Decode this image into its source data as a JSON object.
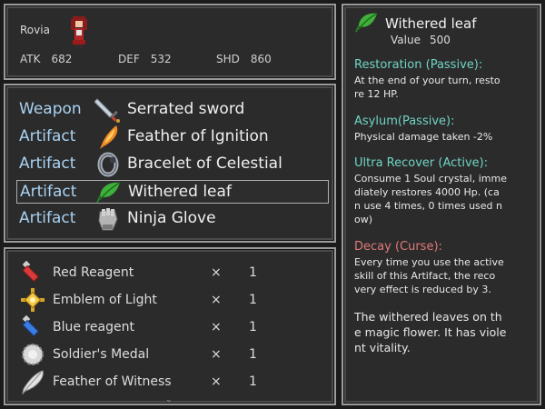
{
  "character": {
    "name": "Rovia",
    "stats": [
      {
        "key": "ATK",
        "value": "682"
      },
      {
        "key": "DEF",
        "value": "532"
      },
      {
        "key": "SHD",
        "value": "860"
      }
    ]
  },
  "equipment": [
    {
      "slot": "Weapon",
      "name": "Serrated sword",
      "icon": "sword-icon"
    },
    {
      "slot": "Artifact",
      "name": "Feather of Ignition",
      "icon": "flame-feather-icon"
    },
    {
      "slot": "Artifact",
      "name": "Bracelet of Celestial",
      "icon": "bracelet-icon"
    },
    {
      "slot": "Artifact",
      "name": "Withered leaf",
      "icon": "leaf-icon",
      "selected": true
    },
    {
      "slot": "Artifact",
      "name": "Ninja Glove",
      "icon": "glove-icon"
    }
  ],
  "inventory": [
    {
      "name": "Red Reagent",
      "x": "×",
      "qty": "1",
      "icon": "red-vial-icon"
    },
    {
      "name": "Emblem of Light",
      "x": "×",
      "qty": "1",
      "icon": "emblem-icon"
    },
    {
      "name": "Blue reagent",
      "x": "×",
      "qty": "1",
      "icon": "blue-vial-icon"
    },
    {
      "name": "Soldier's Medal",
      "x": "×",
      "qty": "1",
      "icon": "medal-icon"
    },
    {
      "name": "Feather of Witness",
      "x": "×",
      "qty": "1",
      "icon": "feather-icon"
    }
  ],
  "inventory_scroll_arrow": "⌄",
  "detail": {
    "title": "Withered leaf",
    "value_label": "Value",
    "value": "500",
    "sections": [
      {
        "title": "Restoration (Passive):",
        "color": "#6fd4c4",
        "body": "At the end of your turn, resto\nre 12 HP."
      },
      {
        "title": "Asylum(Passive):",
        "color": "#6fd4c4",
        "body": "Physical damage taken -2%"
      },
      {
        "title": "Ultra Recover (Active):",
        "color": "#6fd4c4",
        "body": "Consume 1 Soul crystal, imme\ndiately restores 4000 Hp. (ca\nn use 4 times, 0 times used n\now)"
      },
      {
        "title": "Decay (Curse):",
        "color": "#e07a7a",
        "body": "Every time you use the active\n skill of this Artifact, the reco\nvery effect is reduced by 3."
      }
    ],
    "flavor": " The withered leaves on th\ne magic flower. It has viole\nnt vitality."
  }
}
